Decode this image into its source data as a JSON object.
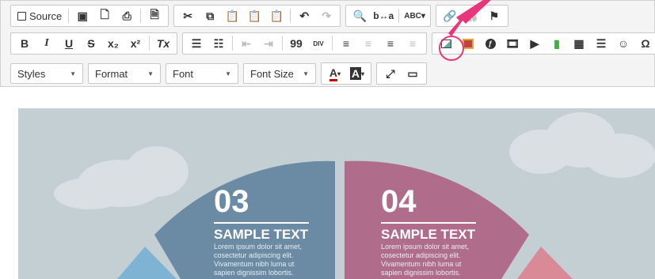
{
  "toolbar": {
    "row1": {
      "source_label": "Source"
    },
    "row2": {
      "bold": "B",
      "italic": "I",
      "underline": "U",
      "strike": "S",
      "subscript": "x₂",
      "superscript": "x²",
      "remove_format": "Tx",
      "blockquote": "99",
      "div": "DIV"
    },
    "row3": {
      "styles": "Styles",
      "format": "Format",
      "font": "Font",
      "font_size": "Font Size",
      "text_color": "A",
      "bg_color": "A"
    }
  },
  "highlight_color": "#e9357a",
  "content": {
    "seg03": {
      "number": "03",
      "title": "SAMPLE TEXT",
      "body": "Lorem ipsum dolor sit amet, cosectetur adipiscing elit. Vivamentum nibh luma ut sapien dignissim lobortis."
    },
    "seg04": {
      "number": "04",
      "title": "SAMPLE TEXT",
      "body": "Lorem ipsum dolor sit amet, cosectetur adipiscing elit. Vivamentum nibh luma ut sapien dignissim lobortis."
    },
    "colors": {
      "blue": "#6b8aa3",
      "pink": "#b06d8b",
      "light_blue": "#7fb3d3",
      "salmon": "#d98a96",
      "bg": "#c4cfd3"
    }
  }
}
